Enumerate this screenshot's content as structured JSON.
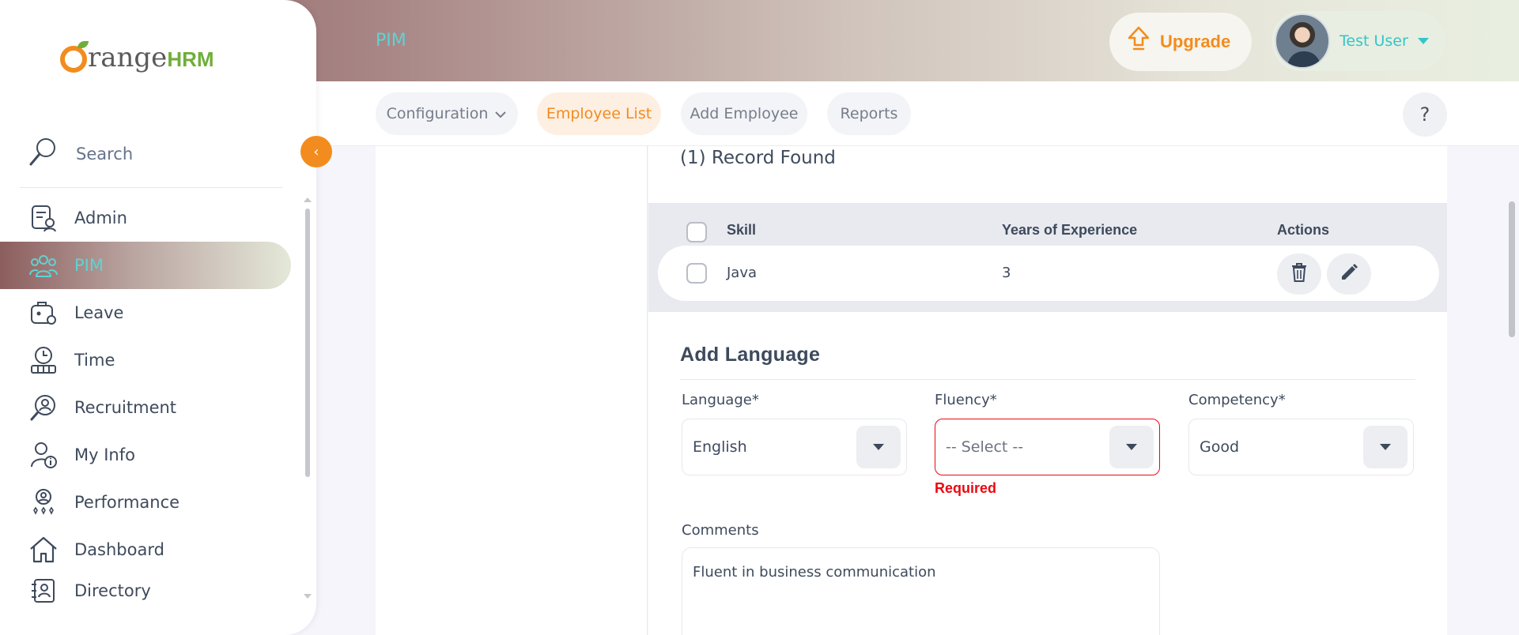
{
  "header": {
    "module_title": "PIM",
    "upgrade_label": "Upgrade",
    "user_name": "Test User"
  },
  "subnav": {
    "configuration": "Configuration",
    "employee_list": "Employee List",
    "add_employee": "Add Employee",
    "reports": "Reports",
    "help": "?"
  },
  "sidebar": {
    "logo_o": "",
    "logo_word": "range",
    "logo_hrm": "HRM",
    "search_label": "Search",
    "items": [
      {
        "label": "Admin",
        "icon": "admin-icon"
      },
      {
        "label": "PIM",
        "icon": "pim-icon",
        "active": true
      },
      {
        "label": "Leave",
        "icon": "leave-icon"
      },
      {
        "label": "Time",
        "icon": "time-icon"
      },
      {
        "label": "Recruitment",
        "icon": "recruitment-icon"
      },
      {
        "label": "My Info",
        "icon": "my-info-icon"
      },
      {
        "label": "Performance",
        "icon": "performance-icon"
      },
      {
        "label": "Dashboard",
        "icon": "dashboard-icon"
      },
      {
        "label": "Directory",
        "icon": "directory-icon"
      }
    ],
    "collapse_glyph": "‹"
  },
  "skills": {
    "record_count": "(1) Record Found",
    "columns": [
      "Skill",
      "Years of Experience",
      "Actions"
    ],
    "rows": [
      {
        "skill": "Java",
        "years": "3"
      }
    ]
  },
  "add_language": {
    "title": "Add Language",
    "language_label": "Language*",
    "language_value": "English",
    "fluency_label": "Fluency*",
    "fluency_value": "-- Select --",
    "fluency_error": "Required",
    "competency_label": "Competency*",
    "competency_value": "Good",
    "comments_label": "Comments",
    "comments_value": "Fluent in business communication"
  },
  "colors": {
    "accent": "#f28c1e",
    "teal": "#5fd3d3",
    "error": "#eb0910"
  }
}
